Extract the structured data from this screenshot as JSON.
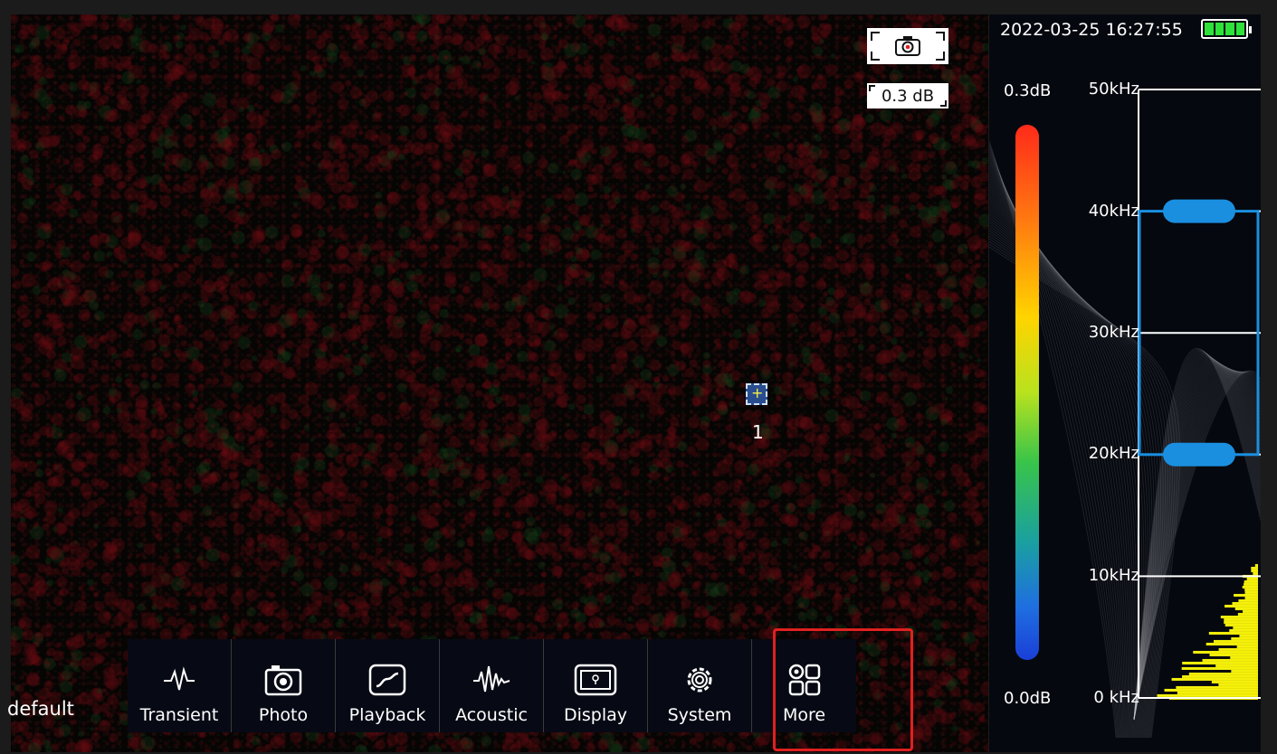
{
  "camera": {
    "snapshot_icon": "camera-capture-icon",
    "db_readout": "0.3 dB",
    "marker_label": "1",
    "preset": "default"
  },
  "toolbar": {
    "items": [
      {
        "label": "Transient",
        "icon": "transient-waveform-icon"
      },
      {
        "label": "Photo",
        "icon": "camera-icon"
      },
      {
        "label": "Playback",
        "icon": "playback-icon"
      },
      {
        "label": "Acoustic",
        "icon": "acoustic-waveform-icon"
      },
      {
        "label": "Display",
        "icon": "display-icon"
      },
      {
        "label": "System",
        "icon": "gear-icon"
      },
      {
        "label": "More",
        "icon": "grid-more-icon"
      }
    ],
    "highlight_color": "#e02020"
  },
  "side": {
    "datetime": "2022-03-25 16:27:55",
    "battery_level": 1.0,
    "battery_color": "#2ee23a",
    "db_max": "0.3dB",
    "db_min": "0.0dB",
    "freq_labels": [
      "50kHz",
      "40kHz",
      "30kHz",
      "20kHz",
      "10kHz",
      "0  kHz"
    ],
    "band_low_khz": 20,
    "band_high_khz": 40,
    "band_color": "#1a8fe0",
    "spectrum_color": "#f5f00a"
  }
}
